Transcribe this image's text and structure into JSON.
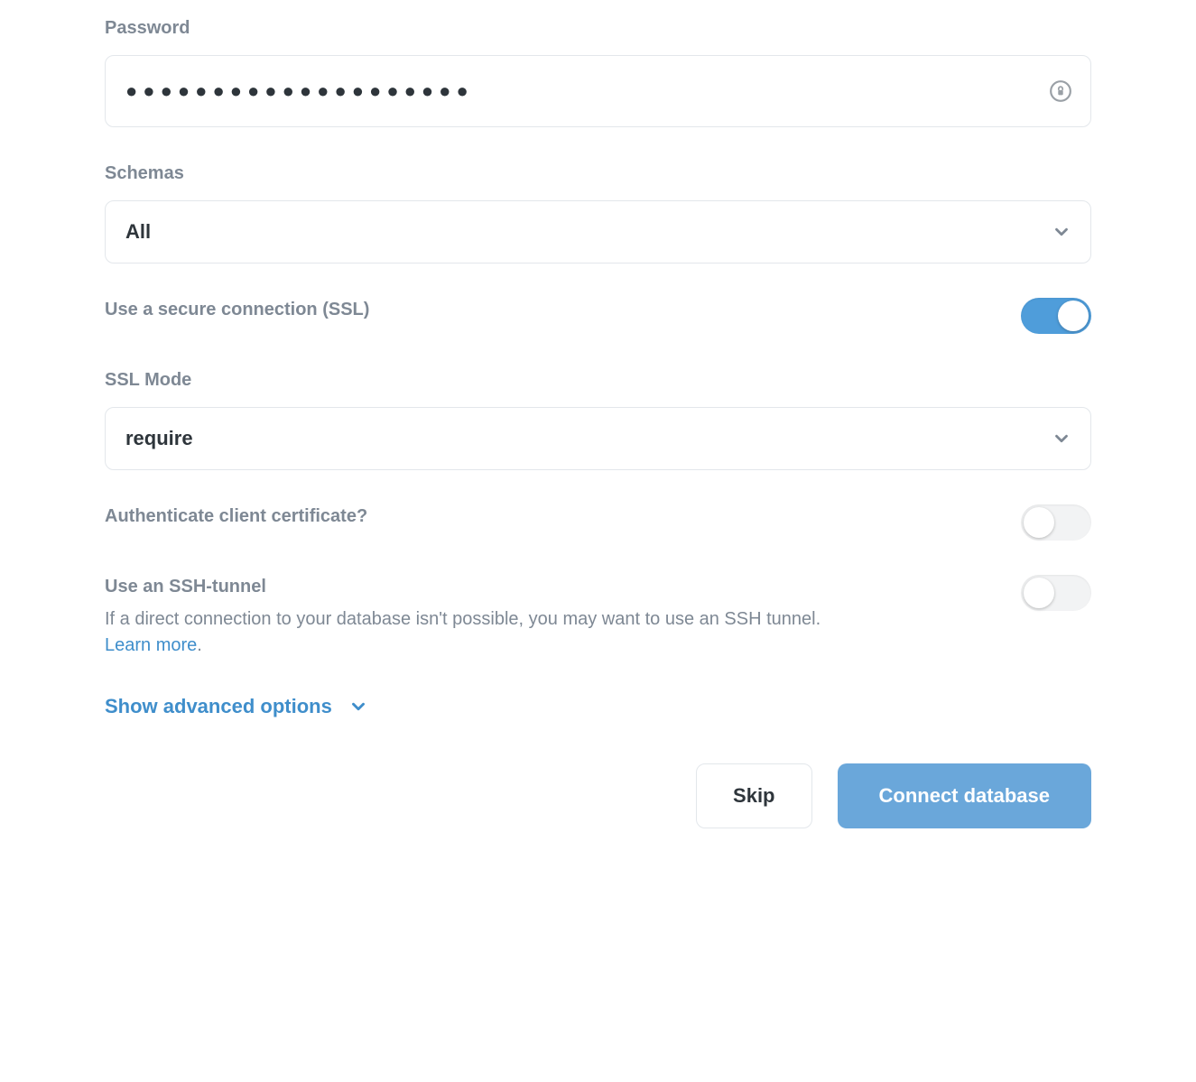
{
  "password": {
    "label": "Password",
    "mask": "●●●●●●●●●●●●●●●●●●●●"
  },
  "schemas": {
    "label": "Schemas",
    "value": "All"
  },
  "ssl": {
    "label": "Use a secure connection (SSL)",
    "enabled": true
  },
  "sslMode": {
    "label": "SSL Mode",
    "value": "require"
  },
  "authClientCert": {
    "label": "Authenticate client certificate?",
    "enabled": false
  },
  "sshTunnel": {
    "label": "Use an SSH-tunnel",
    "enabled": false,
    "help_prefix": "If a direct connection to your database isn't possible, you may want to use an SSH tunnel. ",
    "learn_more": "Learn more",
    "help_suffix": "."
  },
  "advanced": {
    "label": "Show advanced options"
  },
  "buttons": {
    "skip": "Skip",
    "connect": "Connect database"
  }
}
